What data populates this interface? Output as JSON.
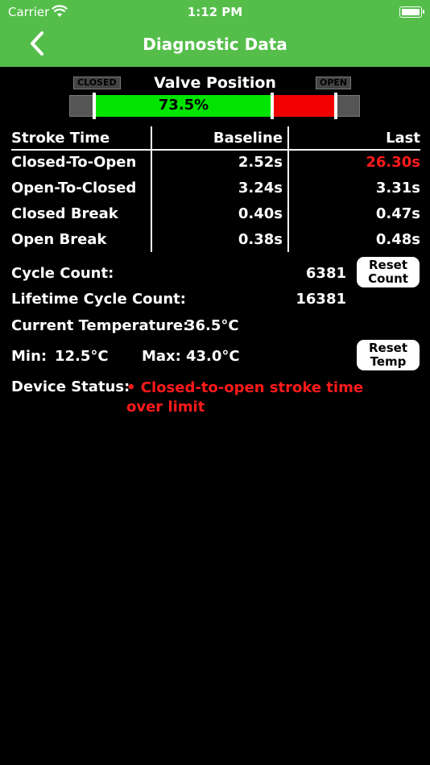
{
  "status_bar": {
    "carrier": "Carrier",
    "time": "1:12 PM"
  },
  "nav": {
    "title": "Diagnostic Data"
  },
  "valve": {
    "closed_label": "CLOSED",
    "open_label": "OPEN",
    "title": "Valve Position",
    "percent_text": "73.5%",
    "percent": 73.5
  },
  "table": {
    "headers": [
      "Stroke Time",
      "Baseline",
      "Last"
    ],
    "rows": [
      {
        "label": "Closed-To-Open",
        "baseline": "2.52s",
        "last": "26.30s",
        "alert": true
      },
      {
        "label": "Open-To-Closed",
        "baseline": "3.24s",
        "last": "3.31s",
        "alert": false
      },
      {
        "label": "Closed Break",
        "baseline": "0.40s",
        "last": "0.47s",
        "alert": false
      },
      {
        "label": "Open Break",
        "baseline": "0.38s",
        "last": "0.48s",
        "alert": false
      }
    ]
  },
  "stats": {
    "cycle_count_label": "Cycle Count:",
    "cycle_count": "6381",
    "reset_count_label": "Reset Count",
    "lifetime_label": "Lifetime Cycle Count:",
    "lifetime_count": "16381",
    "current_temp_label": "Current Temperature:",
    "current_temp": "36.5°C",
    "min_label": "Min:",
    "min_temp": "12.5°C",
    "max_label": "Max:",
    "max_temp": "43.0°C",
    "reset_temp_label": "Reset Temp",
    "device_status_label": "Device Status:",
    "device_status": "• Closed-to-open stroke time over limit"
  },
  "colors": {
    "header": "#55be4b",
    "alert": "#ff1a1a",
    "valve_open": "#00e400",
    "valve_closed": "#f00000"
  }
}
